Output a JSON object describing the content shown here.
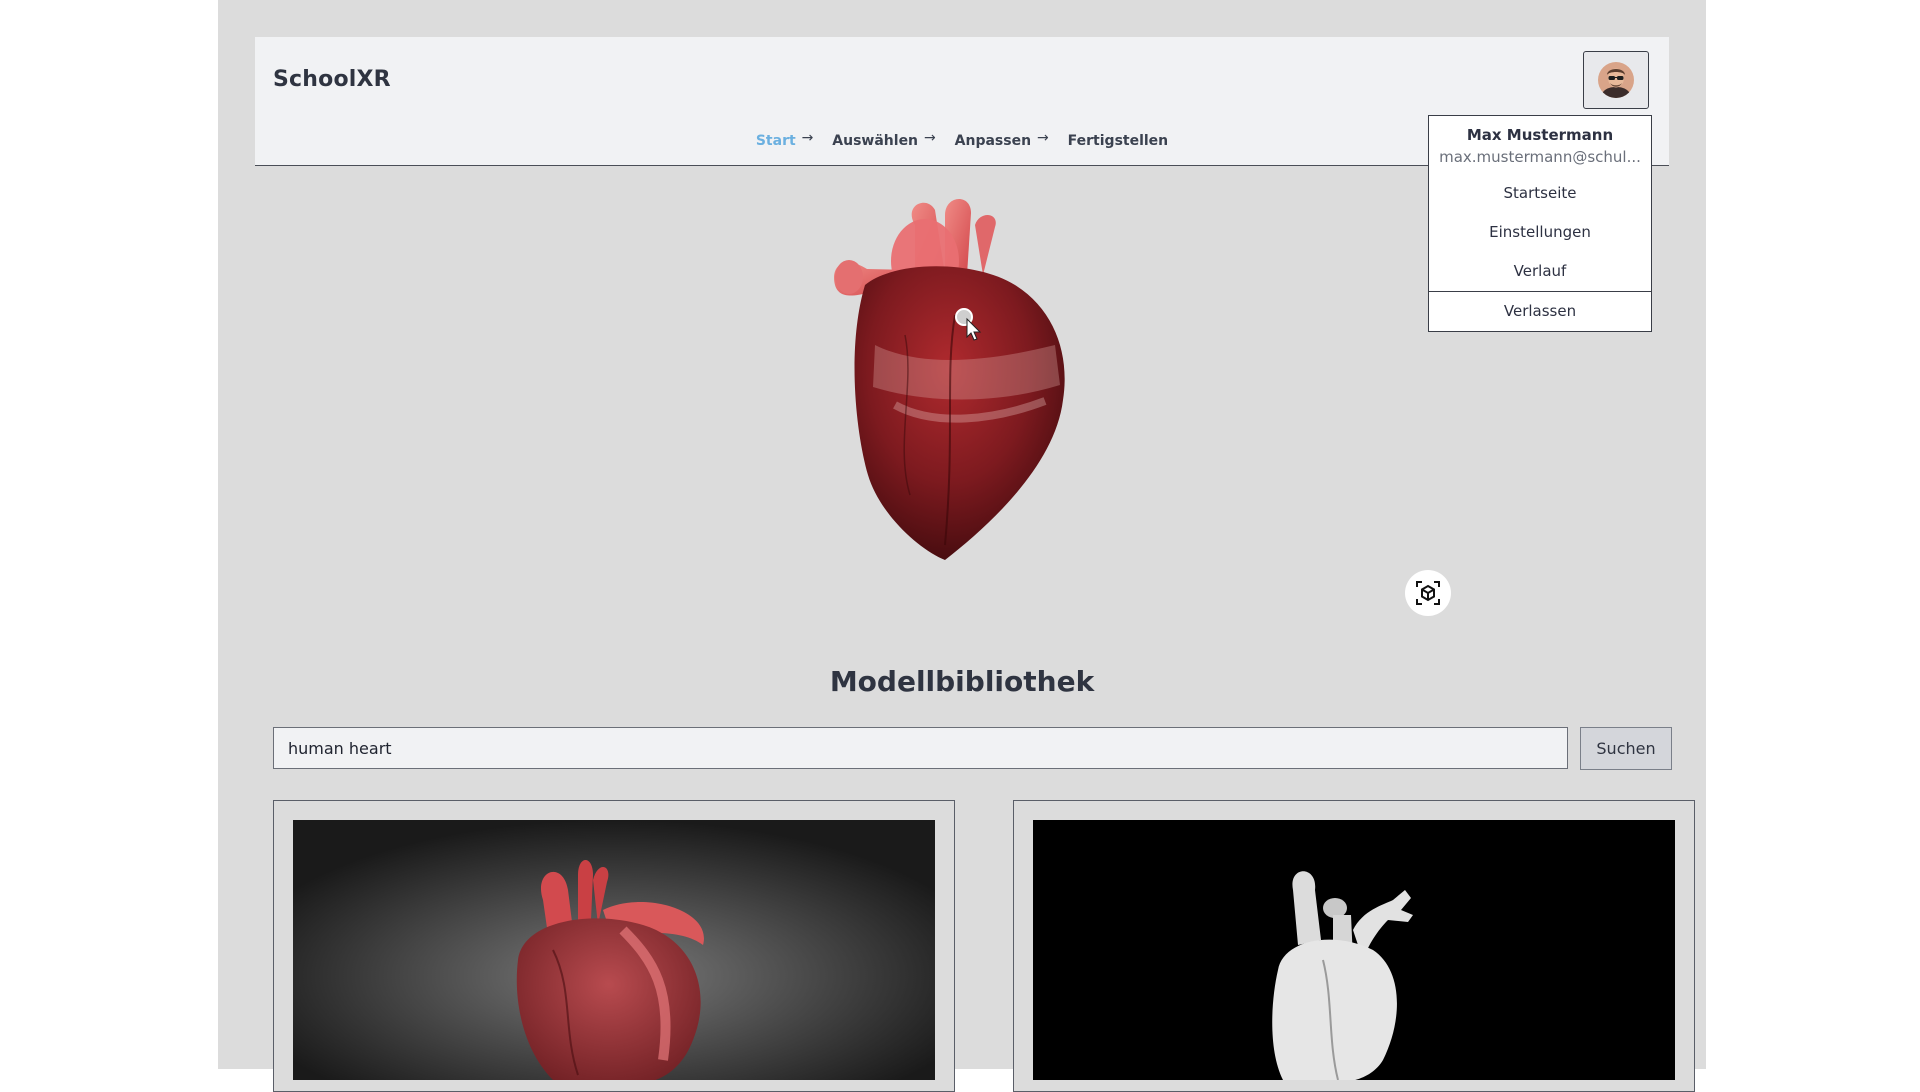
{
  "app": {
    "brand": "SchoolXR"
  },
  "steps": [
    {
      "label": "Start",
      "active": true,
      "arrow": "→"
    },
    {
      "label": "Auswählen",
      "active": false,
      "arrow": "→"
    },
    {
      "label": "Anpassen",
      "active": false,
      "arrow": "→"
    },
    {
      "label": "Fertigstellen",
      "active": false,
      "arrow": ""
    }
  ],
  "user_menu": {
    "name": "Max Mustermann",
    "email": "max.mustermann@schul...",
    "items": [
      "Startseite",
      "Einstellungen",
      "Verlauf"
    ],
    "leave": "Verlassen"
  },
  "library": {
    "title": "Modellbibliothek",
    "search_value": "human heart",
    "search_button": "Suchen"
  },
  "colors": {
    "accent_active_step": "#6bb0e0",
    "frame_background": "#dcdcdc",
    "header_background": "#f1f2f4"
  },
  "icons": {
    "avatar": "user-avatar",
    "ar_view": "ar-cube-icon"
  }
}
